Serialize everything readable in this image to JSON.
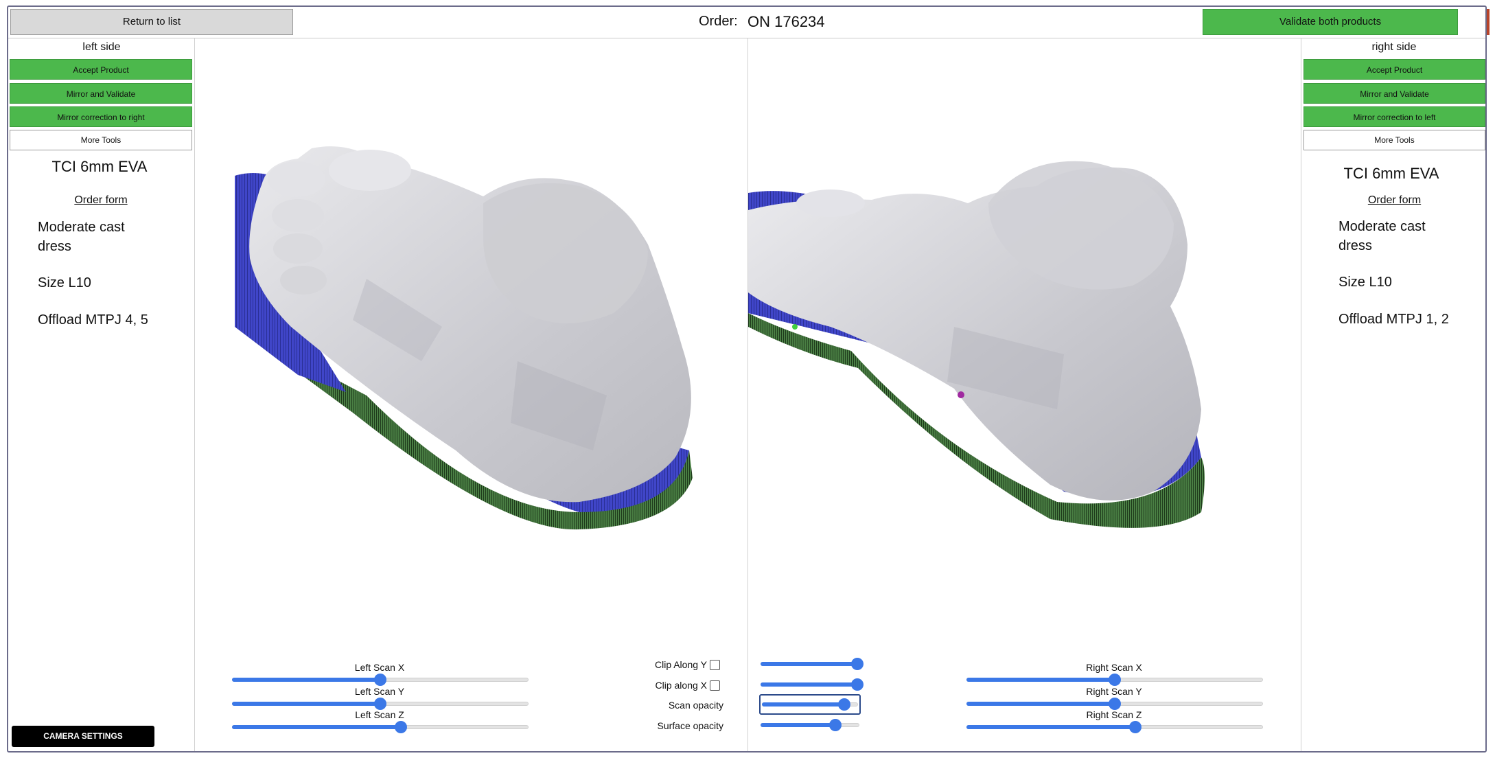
{
  "header": {
    "return_label": "Return to list",
    "order_label": "Order:",
    "order_number": "ON 176234",
    "validate_both_label": "Validate both products"
  },
  "left_panel": {
    "title": "left side",
    "accept_label": "Accept Product",
    "mirror_validate_label": "Mirror and Validate",
    "mirror_correction_label": "Mirror correction to right",
    "more_tools_label": "More Tools",
    "product": "TCI 6mm EVA",
    "order_form_label": "Order form",
    "note_1": "Moderate cast dress",
    "note_2": "Size L10",
    "note_3": "Offload MTPJ 4, 5",
    "camera_settings_label": "CAMERA SETTINGS"
  },
  "right_panel": {
    "title": "right side",
    "accept_label": "Accept Product",
    "mirror_validate_label": "Mirror and Validate",
    "mirror_correction_label": "Mirror correction to left",
    "more_tools_label": "More Tools",
    "product": "TCI 6mm EVA",
    "order_form_label": "Order form",
    "note_1": "Moderate cast dress",
    "note_2": "Size L10",
    "note_3": "Offload MTPJ 1, 2"
  },
  "controls": {
    "left_scan_x_label": "Left Scan X",
    "left_scan_y_label": "Left Scan Y",
    "left_scan_z_label": "Left Scan Z",
    "right_scan_x_label": "Right Scan X",
    "right_scan_y_label": "Right Scan Y",
    "right_scan_z_label": "Right Scan Z",
    "clip_y_label": "Clip Along Y",
    "clip_x_label": "Clip along X",
    "scan_opacity_label": "Scan opacity",
    "surface_opacity_label": "Surface opacity",
    "values": {
      "left_scan_x": 0.5,
      "left_scan_y": 0.5,
      "left_scan_z": 0.57,
      "right_scan_x": 0.5,
      "right_scan_y": 0.5,
      "right_scan_z": 0.57,
      "clip_y": 0.98,
      "clip_x": 0.98,
      "scan_opacity": 0.86,
      "surface_opacity": 0.76
    },
    "clip_y_checked": false,
    "clip_x_checked": false
  },
  "colors": {
    "accent_green": "#4cb84c",
    "slider_blue": "#3b78e7",
    "insole_top": "#3f44c8",
    "insole_side": "#3f7a3a",
    "foot": "#d4d4d8"
  }
}
